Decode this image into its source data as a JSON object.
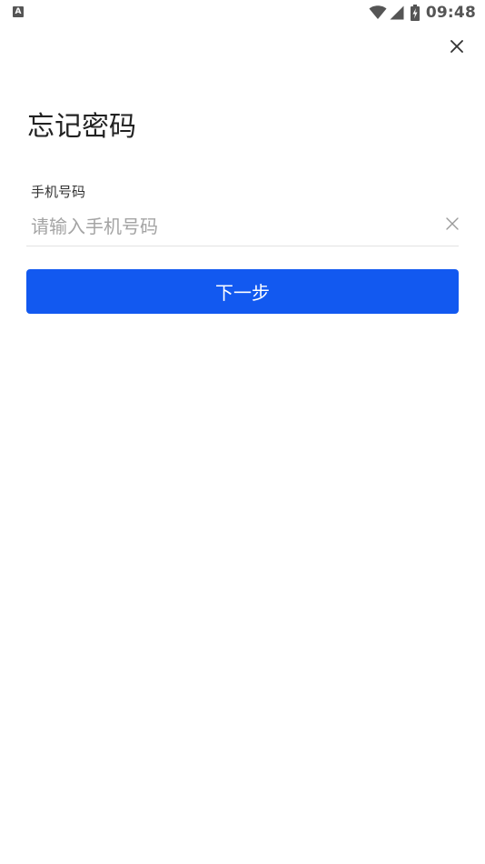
{
  "status_bar": {
    "notification_glyph": "A",
    "time": "09:48",
    "icons": [
      "wifi-icon",
      "signal-icon",
      "battery-charging-icon"
    ]
  },
  "header": {
    "close_icon": "close-icon"
  },
  "page": {
    "title": "忘记密码"
  },
  "form": {
    "phone_label": "手机号码",
    "phone_value": "",
    "phone_placeholder": "请输入手机号码",
    "clear_icon": "clear-icon",
    "next_label": "下一步"
  },
  "colors": {
    "primary": "#1259f0",
    "background": "#ffffff",
    "placeholder": "#a4a4a4",
    "divider": "#e3e3e3"
  }
}
